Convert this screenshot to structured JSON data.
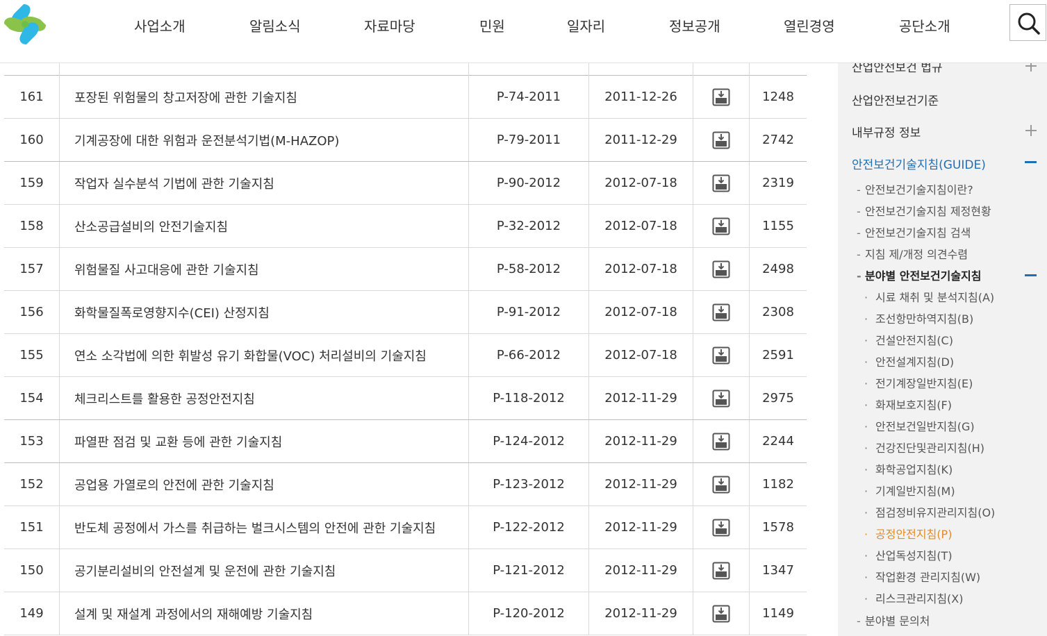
{
  "header": {
    "nav": [
      "사업소개",
      "알림소식",
      "자료마당",
      "민원",
      "일자리",
      "정보공개",
      "열린경영",
      "공단소개"
    ]
  },
  "table": {
    "rows": [
      {
        "num": "161",
        "title": "포장된 위험물의 창고저장에 관한 기술지침",
        "code": "P-74-2011",
        "date": "2011-12-26",
        "views": "1248"
      },
      {
        "num": "160",
        "title": "기계공장에 대한 위험과 운전분석기법(M-HAZOP)",
        "code": "P-79-2011",
        "date": "2011-12-29",
        "views": "2742"
      },
      {
        "num": "159",
        "title": "작업자 실수분석 기법에 관한 기술지침",
        "code": "P-90-2012",
        "date": "2012-07-18",
        "views": "2319"
      },
      {
        "num": "158",
        "title": "산소공급설비의 안전기술지침",
        "code": "P-32-2012",
        "date": "2012-07-18",
        "views": "1155"
      },
      {
        "num": "157",
        "title": "위험물질 사고대응에 관한 기술지침",
        "code": "P-58-2012",
        "date": "2012-07-18",
        "views": "2498"
      },
      {
        "num": "156",
        "title": "화학물질폭로영향지수(CEI) 산정지침",
        "code": "P-91-2012",
        "date": "2012-07-18",
        "views": "2308"
      },
      {
        "num": "155",
        "title": "연소 소각법에 의한 휘발성 유기 화합물(VOC) 처리설비의 기술지침",
        "code": "P-66-2012",
        "date": "2012-07-18",
        "views": "2591"
      },
      {
        "num": "154",
        "title": "체크리스트를 활용한 공정안전지침",
        "code": "P-118-2012",
        "date": "2012-11-29",
        "views": "2975"
      },
      {
        "num": "153",
        "title": "파열판 점검 및 교환 등에 관한 기술지침",
        "code": "P-124-2012",
        "date": "2012-11-29",
        "views": "2244"
      },
      {
        "num": "152",
        "title": "공업용 가열로의 안전에 관한 기술지침",
        "code": "P-123-2012",
        "date": "2012-11-29",
        "views": "1182"
      },
      {
        "num": "151",
        "title": "반도체 공정에서 가스를 취급하는 벌크시스템의 안전에 관한 기술지침",
        "code": "P-122-2012",
        "date": "2012-11-29",
        "views": "1578"
      },
      {
        "num": "150",
        "title": "공기분리설비의 안전설계 및 운전에 관한 기술지침",
        "code": "P-121-2012",
        "date": "2012-11-29",
        "views": "1347"
      },
      {
        "num": "149",
        "title": "설계 및 재설계 과정에서의 재해예방 기술지침",
        "code": "P-120-2012",
        "date": "2012-11-29",
        "views": "1149"
      }
    ]
  },
  "sidebar": {
    "top_cut": "산업안전보건 법규",
    "standard": "산업안전보건기준",
    "internal": "내부규정 정보",
    "guide": "안전보건기술지침(GUIDE)",
    "guide_subs": [
      "안전보건기술지침이란?",
      "안전보건기술지침 제정현황",
      "안전보건기술지침 검색",
      "지침 제/개정 의견수렴",
      "분야별 안전보건기술지침"
    ],
    "field_subs": [
      "시료 채취 및 분석지침(A)",
      "조선항만하역지침(B)",
      "건설안전지침(C)",
      "안전설계지침(D)",
      "전기계장일반지침(E)",
      "화재보호지침(F)",
      "안전보건일반지침(G)",
      "건강진단및관리지침(H)",
      "화학공업지침(K)",
      "기계일반지침(M)",
      "점검정비유지관리지침(O)",
      "공정안전지침(P)",
      "산업독성지침(T)",
      "작업환경 관리지침(W)",
      "리스크관리지침(X)"
    ],
    "contact": "분야별 문의처"
  },
  "colors": {
    "active_blue": "#1f6fb5",
    "current_orange": "#e58a1f",
    "sidebar_bg": "#f2f2f2"
  }
}
